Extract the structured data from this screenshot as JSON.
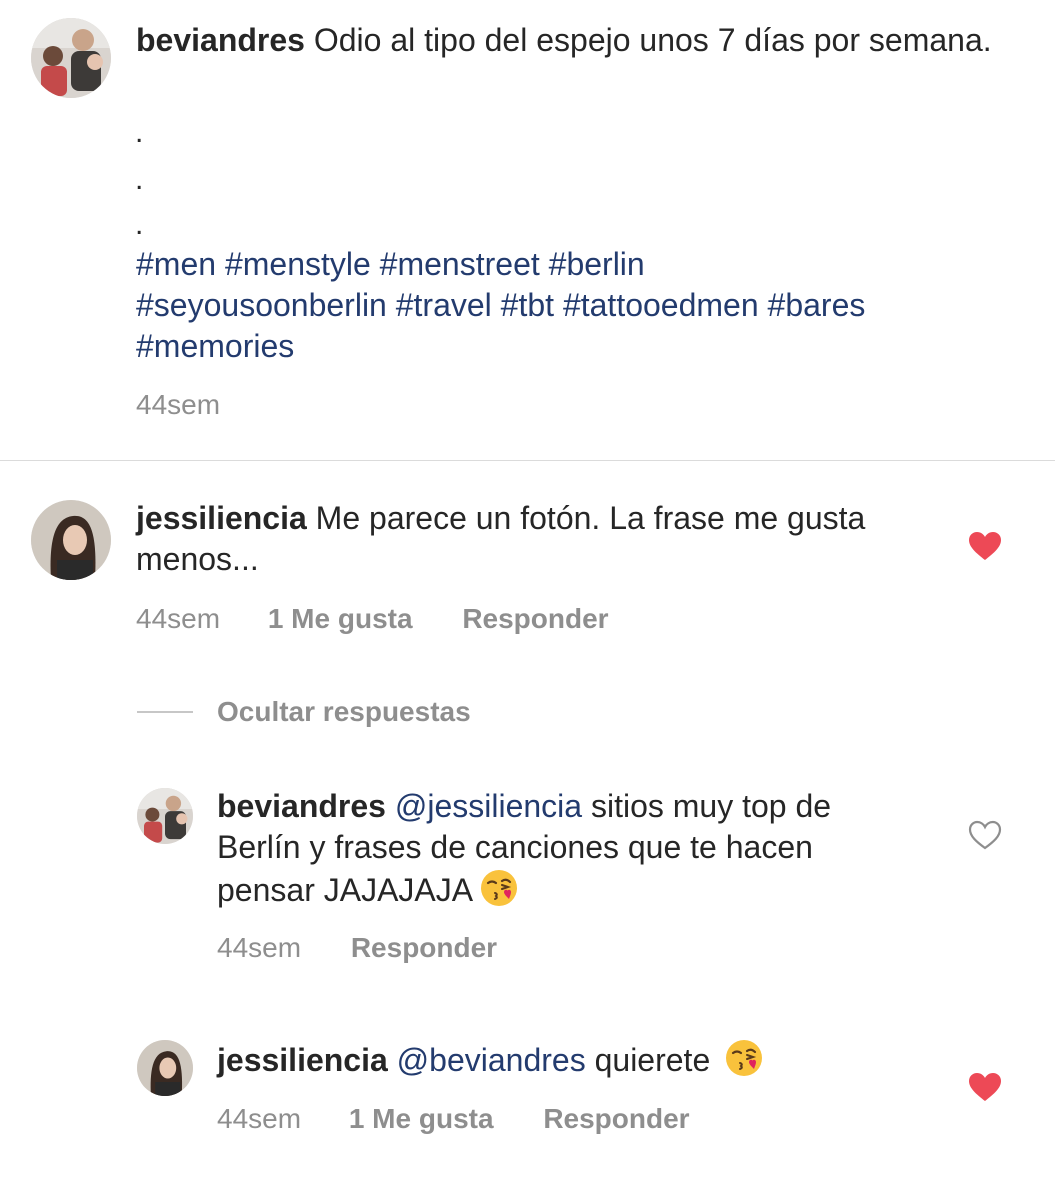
{
  "caption": {
    "username": "beviandres",
    "text": "Odio al tipo del espejo unos 7 días por semana.",
    "dots": [
      ".",
      ".",
      "."
    ],
    "hashtags": [
      "#men",
      "#menstyle",
      "#menstreet",
      "#berlin",
      "#seyousoonberlin",
      "#travel",
      "#tbt",
      "#tattooedmen",
      "#bares",
      "#memories"
    ],
    "time": "44sem"
  },
  "comments": [
    {
      "username": "jessiliencia",
      "text": "Me parece un fotón. La frase me gusta menos...",
      "time": "44sem",
      "likes": "1 Me gusta",
      "reply": "Responder",
      "liked": true
    }
  ],
  "hide_replies": "Ocultar respuestas",
  "replies": [
    {
      "username": "beviandres",
      "mention": "@jessiliencia",
      "text": "sitios muy top de Berlín y frases de canciones que te hacen pensar JAJAJAJA",
      "emoji": "face-blowing-kiss-icon",
      "time": "44sem",
      "reply": "Responder",
      "liked": false
    },
    {
      "username": "jessiliencia",
      "mention": "@beviandres",
      "text": "quierete",
      "emoji": "face-blowing-kiss-icon",
      "time": "44sem",
      "likes": "1 Me gusta",
      "reply": "Responder",
      "liked": true
    }
  ],
  "colors": {
    "heart_liked": "#ed4956",
    "link": "#233b6e",
    "secondary_text": "#8e8e8e"
  }
}
